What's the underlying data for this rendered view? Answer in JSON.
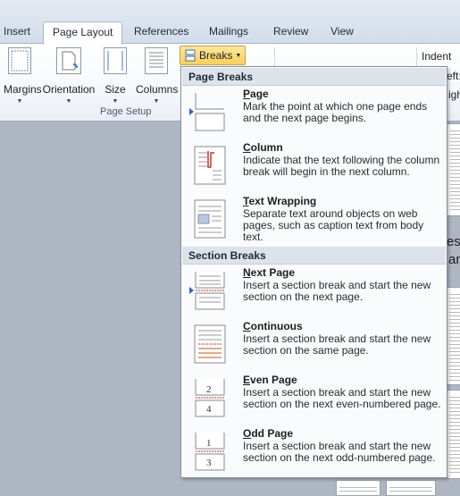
{
  "tabs": [
    {
      "label": "Insert"
    },
    {
      "label": "Page Layout"
    },
    {
      "label": "References"
    },
    {
      "label": "Mailings"
    },
    {
      "label": "Review"
    },
    {
      "label": "View"
    }
  ],
  "ribbon": {
    "margins_label": "Margins",
    "orientation_label": "Orientation",
    "size_label": "Size",
    "columns_label": "Columns",
    "breaks_label": "Breaks",
    "group_label": "Page Setup",
    "indent_label": "Indent",
    "left_fragment": "eft:",
    "right_fragment": "igh"
  },
  "menu": {
    "page_breaks_header": "Page Breaks",
    "section_breaks_header": "Section Breaks",
    "items": [
      {
        "title": "Page",
        "description": "Mark the point at which one page ends and the next page begins."
      },
      {
        "title": "Column",
        "description": "Indicate that the text following the column break will begin in the next column."
      },
      {
        "title": "Text Wrapping",
        "description": "Separate text around objects on web pages, such as caption text from body text."
      },
      {
        "title": "Next Page",
        "description": "Insert a section break and start the new section on the next page."
      },
      {
        "title": "Continuous",
        "description": "Insert a section break and start the new section on the same page."
      },
      {
        "title": "Even Page",
        "description": "Insert a section break and start the new section on the next even-numbered page."
      },
      {
        "title": "Odd Page",
        "description": "Insert a section break and start the new section on the next odd-numbered page."
      }
    ]
  },
  "document_fragments": {
    "line1": "es",
    "line2": "an"
  },
  "colors": {
    "accent": "#3465c4",
    "section_red": "#c0392b",
    "breaks_highlight": "#f9cf5a"
  }
}
